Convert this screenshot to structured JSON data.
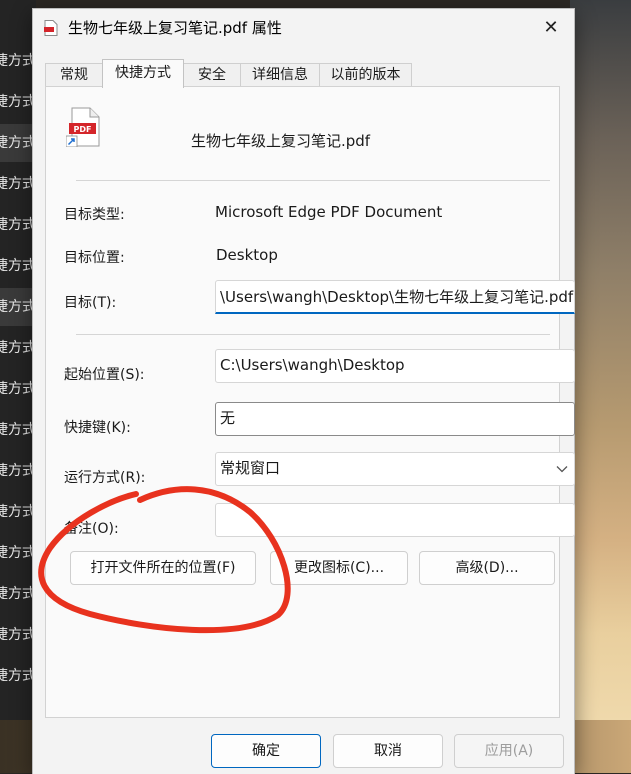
{
  "background": {
    "list_label": "捷方式",
    "row_count": 16
  },
  "window": {
    "title": "生物七年级上复习笔记.pdf 属性",
    "close_glyph": "✕"
  },
  "tabs": [
    {
      "label": "常规"
    },
    {
      "label": "快捷方式"
    },
    {
      "label": "安全"
    },
    {
      "label": "详细信息"
    },
    {
      "label": "以前的版本"
    }
  ],
  "shortcut": {
    "file_name": "生物七年级上复习笔记.pdf",
    "icon_text": "PDF",
    "target_type_label": "目标类型:",
    "target_type_value": "Microsoft Edge PDF Document",
    "target_location_label": "目标位置:",
    "target_location_value": "Desktop",
    "target_label": "目标(T):",
    "target_value": "\\Users\\wangh\\Desktop\\生物七年级上复习笔记.pdf",
    "start_in_label": "起始位置(S):",
    "start_in_value": "C:\\Users\\wangh\\Desktop",
    "hotkey_label": "快捷键(K):",
    "hotkey_value": "无",
    "run_label": "运行方式(R):",
    "run_value": "常规窗口",
    "comment_label": "备注(O):",
    "comment_value": "",
    "open_location_button": "打开文件所在的位置(F)",
    "change_icon_button": "更改图标(C)...",
    "advanced_button": "高级(D)..."
  },
  "footer": {
    "ok": "确定",
    "cancel": "取消",
    "apply": "应用(A)"
  },
  "colors": {
    "annotation": "#e8321e",
    "focus_underline": "#0067c0",
    "pdf_red": "#d4252a"
  }
}
